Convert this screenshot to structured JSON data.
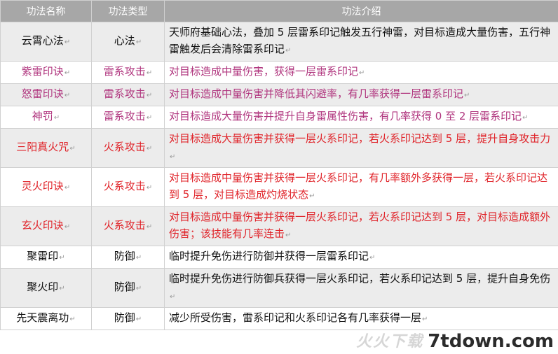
{
  "header": {
    "col_name": "功法名称",
    "col_type": "功法类型",
    "col_desc": "功法介绍"
  },
  "para_mark": "↵",
  "colors": {
    "black": "#111111",
    "purple": "#b0357e",
    "red": "#e0242a",
    "header_bg": "#a7a7a7"
  },
  "rows": [
    {
      "name": "云霄心法",
      "type": "心法",
      "desc": "天师府基础心法，叠加 5 层雷系印记触发五行神雷，对目标造成大量伤害，五行神雷触发后会清除雷系印记",
      "color": "black",
      "shaded": true
    },
    {
      "name": "紫雷印诀",
      "type": "雷系攻击",
      "desc": "对目标造成中量伤害，获得一层雷系印记",
      "color": "purple",
      "shaded": false
    },
    {
      "name": "怒雷印诀",
      "type": "雷系攻击",
      "desc": "对目标造成中量伤害并降低其闪避率，有几率获得一层雷系印记",
      "color": "purple",
      "shaded": true
    },
    {
      "name": "神罚",
      "type": "雷系攻击",
      "desc": "对目标造成大量伤害并提升自身雷属性伤害，有几率获得 0 至 2 层雷系印记",
      "color": "purple",
      "shaded": false
    },
    {
      "name": "三阳真火咒",
      "type": "火系攻击",
      "desc": "对目标造成大量伤害并获得一层火系印记，若火系印记达到 5 层，提升自身攻击力",
      "color": "red",
      "shaded": true
    },
    {
      "name": "灵火印诀",
      "type": "火系攻击",
      "desc": "对目标造成中量伤害并获得一层火系印记，有几率额外多获得一层，若火系印记达到 5 层，对目标造成灼烧状态",
      "color": "red",
      "shaded": false
    },
    {
      "name": "玄火印诀",
      "type": "火系攻击",
      "desc": "对目标造成中量伤害并获得一层火系印记，若火系印记达到 5 层，对目标造成额外伤害；该技能有几率连击",
      "color": "red",
      "shaded": true
    },
    {
      "name": "聚雷印",
      "type": "防御",
      "desc": "临时提升免伤进行防御并获得一层雷系印记",
      "color": "black",
      "shaded": false
    },
    {
      "name": "聚火印",
      "type": "防御",
      "desc": "临时提升免伤进行防御兵获得一层火系印记，若火系印记达到 5 层，提升自身免伤",
      "color": "black",
      "shaded": true
    },
    {
      "name": "先天震离功",
      "type": "防御",
      "desc": "减少所受伤害，雷系印记和火系印记各有几率获得一层",
      "color": "black",
      "shaded": false
    }
  ],
  "watermark": {
    "text": "7tdown.com"
  }
}
